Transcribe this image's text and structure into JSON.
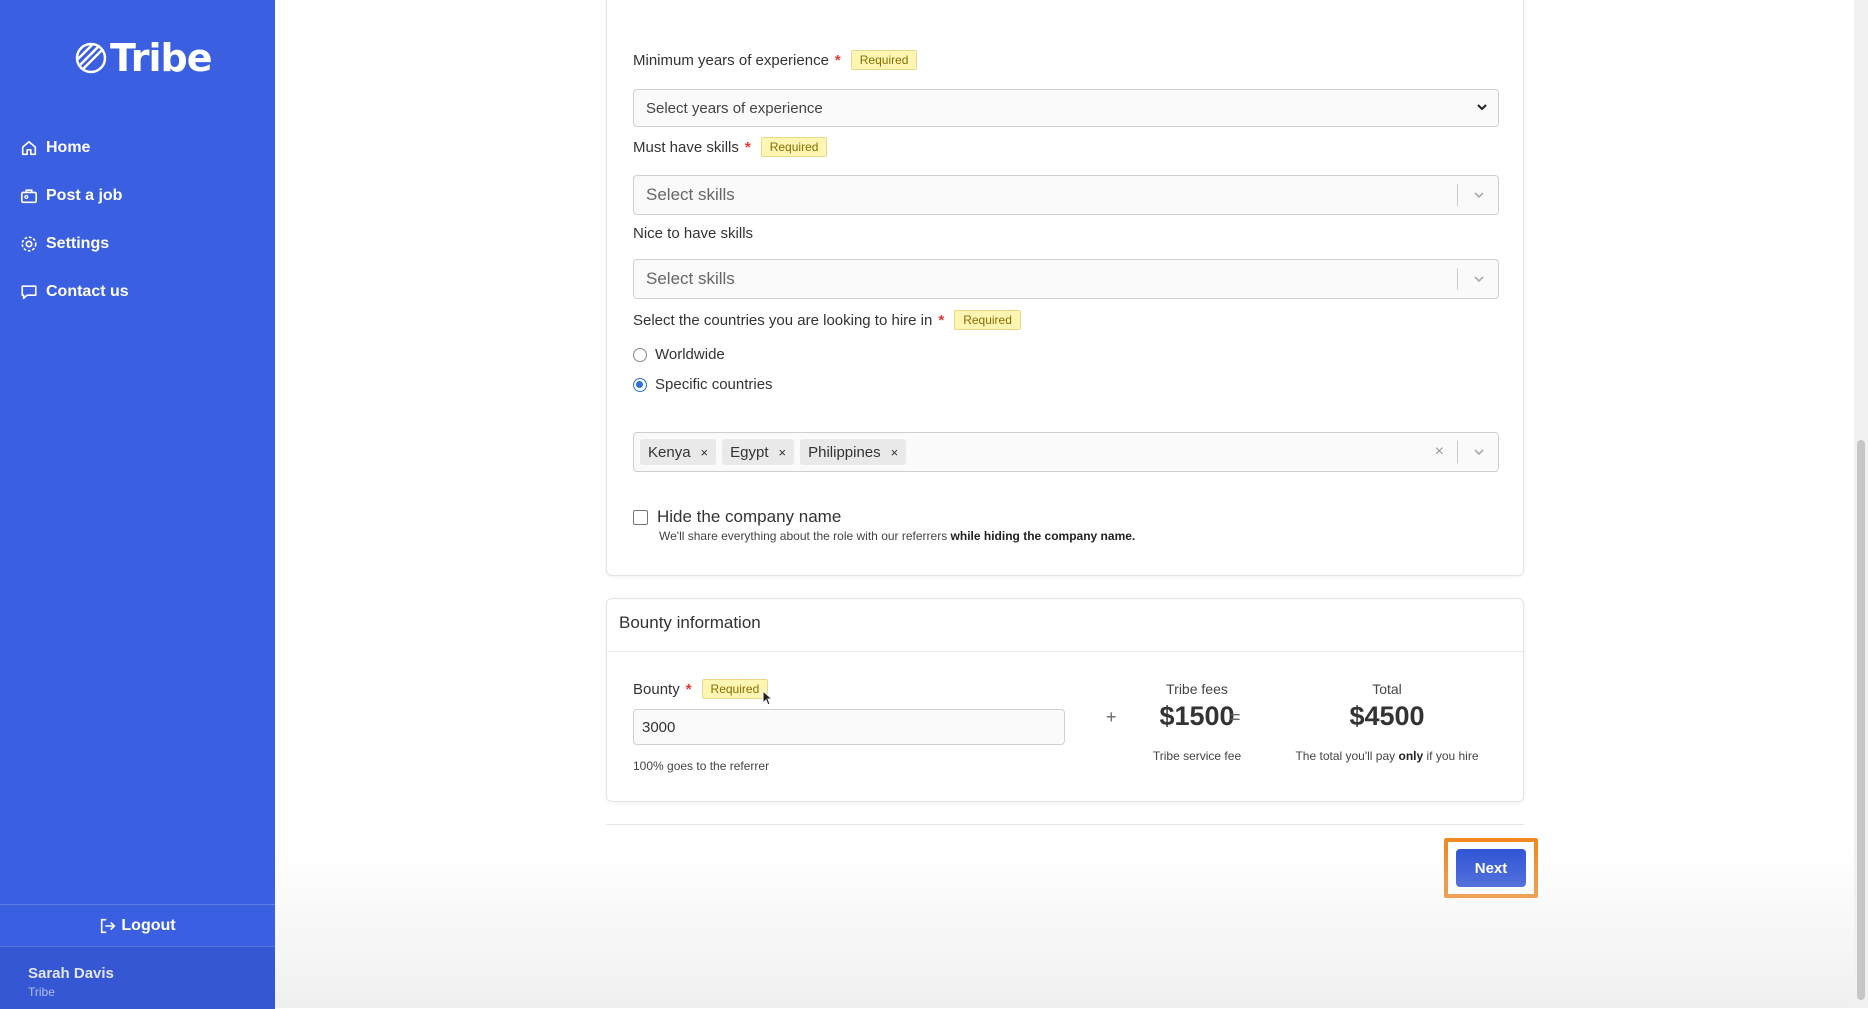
{
  "brand": {
    "name": "Tribe"
  },
  "sidebar": {
    "items": [
      {
        "label": "Home",
        "icon": "home-icon"
      },
      {
        "label": "Post a job",
        "icon": "briefcase-icon"
      },
      {
        "label": "Settings",
        "icon": "gear-icon"
      },
      {
        "label": "Contact us",
        "icon": "chat-icon"
      }
    ],
    "logout_label": "Logout",
    "user": {
      "name": "Sarah Davis",
      "org": "Tribe"
    }
  },
  "form": {
    "required_badge": "Required",
    "experience": {
      "label": "Minimum years of experience",
      "value": "Select years of experience"
    },
    "must_skills": {
      "label": "Must have skills",
      "placeholder": "Select skills"
    },
    "nice_skills": {
      "label": "Nice to have skills",
      "placeholder": "Select skills"
    },
    "countries": {
      "label": "Select the countries you are looking to hire in",
      "options": [
        {
          "label": "Worldwide",
          "selected": false
        },
        {
          "label": "Specific countries",
          "selected": true
        }
      ],
      "selected_tags": [
        "Kenya",
        "Egypt",
        "Philippines"
      ],
      "tag_remove": "×",
      "clear": "×"
    },
    "hide_company": {
      "label": "Hide the company name",
      "checked": false,
      "hint_prefix": "We'll share everything about the role with our referrers ",
      "hint_bold": "while hiding the company name."
    }
  },
  "bounty": {
    "section_title": "Bounty information",
    "label": "Bounty",
    "value": "3000",
    "note": "100% goes to the referrer",
    "plus": "+",
    "equals": "=",
    "fees_label": "Tribe fees",
    "fees_amount": "$1500",
    "fees_note": "Tribe service fee",
    "total_label": "Total",
    "total_amount": "$4500",
    "total_note_prefix": "The total you'll pay ",
    "total_note_bold": "only",
    "total_note_suffix": " if you hire"
  },
  "actions": {
    "next_label": "Next"
  },
  "colors": {
    "sidebar": "#3a5fe0",
    "primary_button": "#2f54d6",
    "highlight": "#f08a24",
    "required_bg": "#fff6b3"
  }
}
